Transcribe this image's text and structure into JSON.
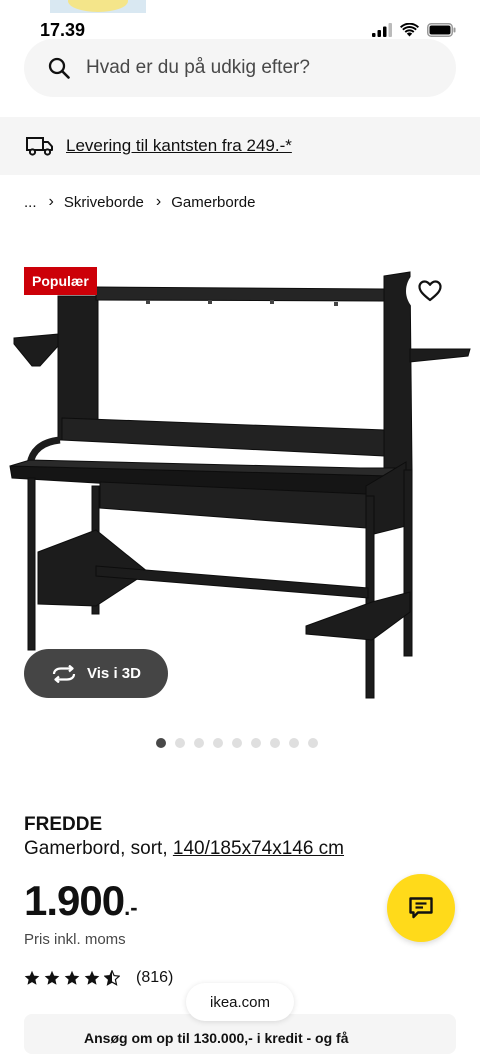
{
  "status_bar": {
    "time": "17.39"
  },
  "search": {
    "placeholder": "Hvad er du på udkig efter?"
  },
  "delivery_banner": {
    "text": "Levering til kantsten fra 249.-*"
  },
  "breadcrumb": {
    "ellipsis": "...",
    "items": [
      "Skriveborde",
      "Gamerborde"
    ]
  },
  "product": {
    "badge": "Populær",
    "view_3d_label": "Vis i 3D",
    "image_count": 9,
    "active_image_index": 0,
    "name": "FREDDE",
    "description_prefix": "Gamerbord, sort, ",
    "dimensions": "140/185x74x146 cm",
    "price": "1.900",
    "price_suffix": ".-",
    "vat_note": "Pris inkl. moms",
    "rating_stars": 4.5,
    "rating_max": 5,
    "review_count": "(816)"
  },
  "credit_banner": {
    "text": "Ansøg om op til 130.000,- i kredit - og få"
  },
  "browser": {
    "domain": "ikea.com"
  },
  "colors": {
    "badge_red": "#cc0008",
    "chat_yellow": "#ffda1a",
    "surface_grey": "#f5f5f5"
  },
  "icons": [
    "signal-icon",
    "wifi-icon",
    "battery-icon",
    "search-icon",
    "truck-icon",
    "chevron-right-icon",
    "heart-icon",
    "rotate-3d-icon",
    "chat-icon",
    "star-icon"
  ]
}
